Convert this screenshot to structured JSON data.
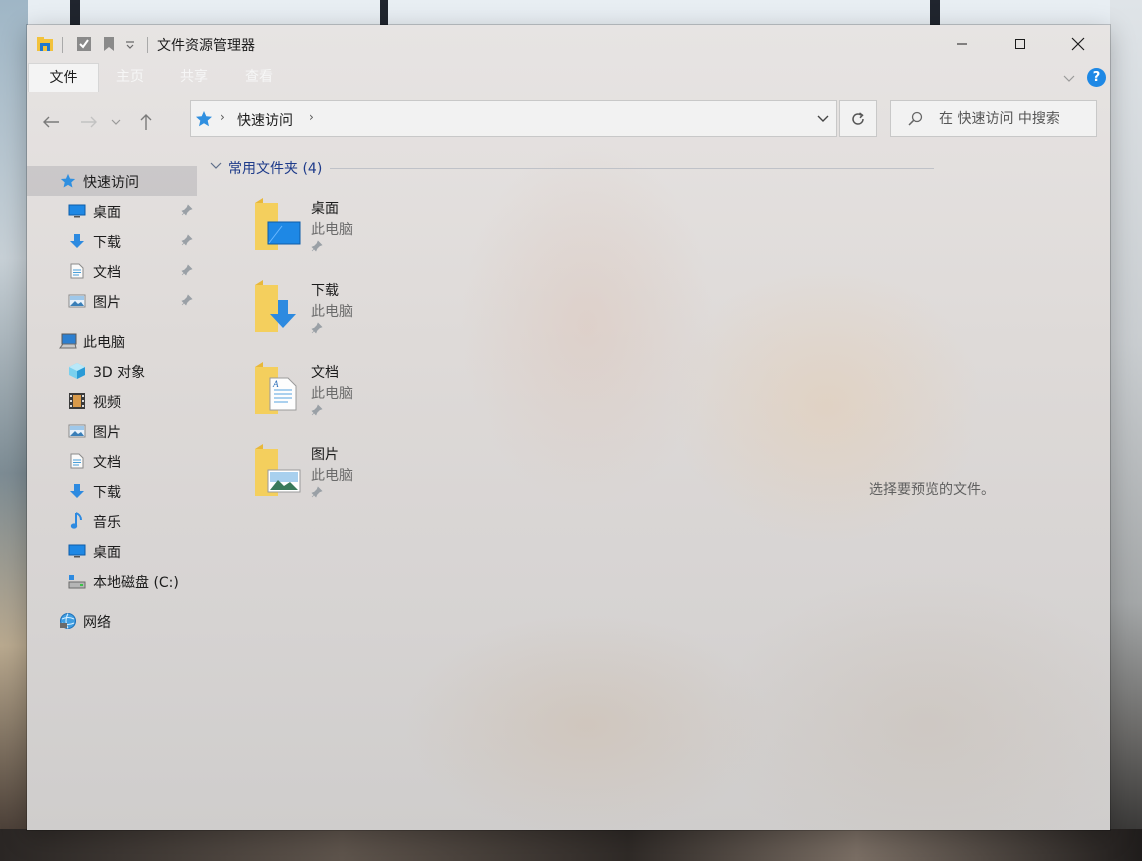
{
  "window": {
    "title": "文件资源管理器",
    "controls": {
      "minimize": "minimize",
      "maximize": "maximize",
      "close": "close"
    }
  },
  "ribbon": {
    "tabs": [
      {
        "label": "文件",
        "active": true
      },
      {
        "label": "主页",
        "active": false
      },
      {
        "label": "共享",
        "active": false
      },
      {
        "label": "查看",
        "active": false
      }
    ]
  },
  "address": {
    "crumbs": [
      "快速访问"
    ],
    "search_placeholder": "在 快速访问 中搜索"
  },
  "nav": {
    "quick_access": "快速访问",
    "quick_items": [
      {
        "label": "桌面",
        "icon": "desktop-icon",
        "pinned": true
      },
      {
        "label": "下载",
        "icon": "download-icon",
        "pinned": true
      },
      {
        "label": "文档",
        "icon": "document-icon",
        "pinned": true
      },
      {
        "label": "图片",
        "icon": "picture-icon",
        "pinned": true
      }
    ],
    "this_pc": "此电脑",
    "pc_items": [
      {
        "label": "3D 对象",
        "icon": "3d-object-icon"
      },
      {
        "label": "视频",
        "icon": "video-icon"
      },
      {
        "label": "图片",
        "icon": "picture-icon"
      },
      {
        "label": "文档",
        "icon": "document-icon"
      },
      {
        "label": "下载",
        "icon": "download-icon"
      },
      {
        "label": "音乐",
        "icon": "music-icon"
      },
      {
        "label": "桌面",
        "icon": "desktop-icon"
      },
      {
        "label": "本地磁盘 (C:)",
        "icon": "local-disk-icon"
      }
    ],
    "network": "网络"
  },
  "content": {
    "group_title": "常用文件夹 (4)",
    "folders": [
      {
        "name": "桌面",
        "location": "此电脑",
        "icon": "folder-desktop-icon"
      },
      {
        "name": "下载",
        "location": "此电脑",
        "icon": "folder-download-icon"
      },
      {
        "name": "文档",
        "location": "此电脑",
        "icon": "folder-document-icon"
      },
      {
        "name": "图片",
        "location": "此电脑",
        "icon": "folder-picture-icon"
      }
    ],
    "preview_message": "选择要预览的文件。"
  },
  "colors": {
    "accent": "#1e3b8a",
    "folder_yellow": "#f4c542",
    "help_blue": "#1e88e5"
  }
}
